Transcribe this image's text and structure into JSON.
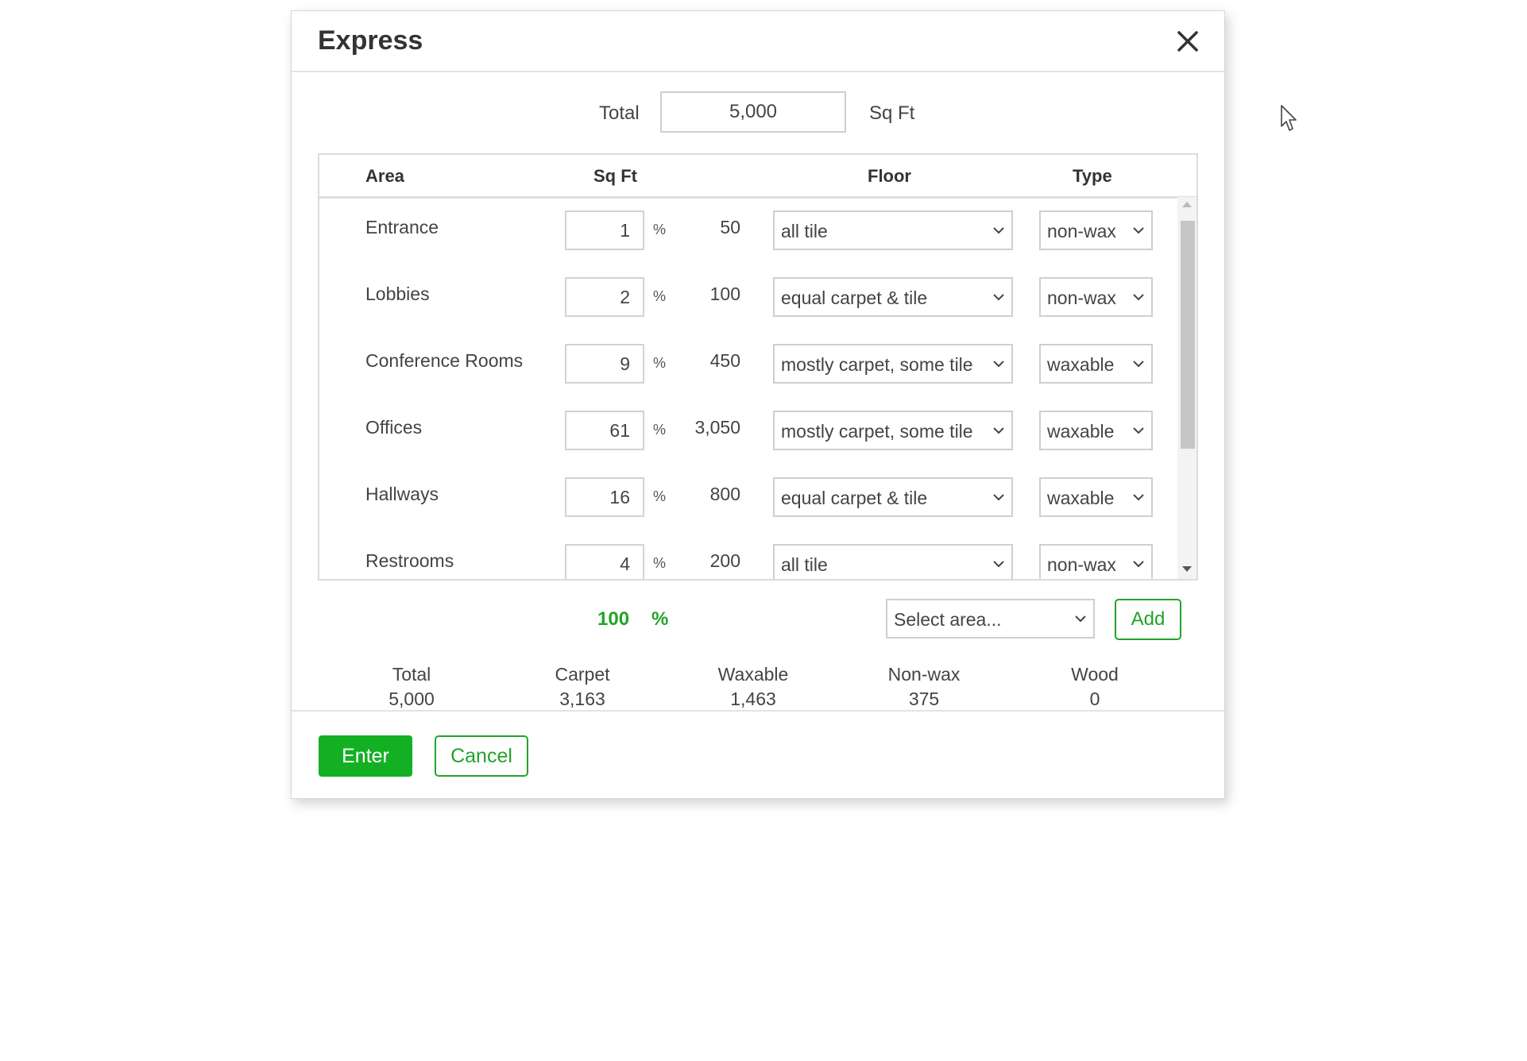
{
  "dialog": {
    "title": "Express",
    "total_label": "Total",
    "total_value": "5,000",
    "total_unit": "Sq Ft"
  },
  "table": {
    "headers": {
      "area": "Area",
      "sqft": "Sq Ft",
      "floor": "Floor",
      "type": "Type"
    },
    "rows": [
      {
        "area": "Entrance",
        "pct": "1",
        "pct_sign": "%",
        "sqft": "50",
        "floor": "all tile",
        "type": "non-wax"
      },
      {
        "area": "Lobbies",
        "pct": "2",
        "pct_sign": "%",
        "sqft": "100",
        "floor": "equal carpet & tile",
        "type": "non-wax"
      },
      {
        "area": "Conference Rooms",
        "pct": "9",
        "pct_sign": "%",
        "sqft": "450",
        "floor": "mostly carpet, some tile",
        "type": "waxable"
      },
      {
        "area": "Offices",
        "pct": "61",
        "pct_sign": "%",
        "sqft": "3,050",
        "floor": "mostly carpet, some tile",
        "type": "waxable"
      },
      {
        "area": "Hallways",
        "pct": "16",
        "pct_sign": "%",
        "sqft": "800",
        "floor": "equal carpet & tile",
        "type": "waxable"
      },
      {
        "area": "Restrooms",
        "pct": "4",
        "pct_sign": "%",
        "sqft": "200",
        "floor": "all tile",
        "type": "non-wax"
      }
    ]
  },
  "totals_row": {
    "pct": "100",
    "pct_sign": "%",
    "area_select_placeholder": "Select area...",
    "add_label": "Add"
  },
  "summary": {
    "total_label": "Total",
    "total_value": "5,000",
    "carpet_label": "Carpet",
    "carpet_value": "3,163",
    "waxable_label": "Waxable",
    "waxable_value": "1,463",
    "nonwax_label": "Non-wax",
    "nonwax_value": "375",
    "wood_label": "Wood",
    "wood_value": "0"
  },
  "footer": {
    "enter_label": "Enter",
    "cancel_label": "Cancel"
  },
  "colors": {
    "accent_green": "#22a32a",
    "enter_green": "#14b024"
  },
  "icons": {
    "close": "close-icon",
    "dropdown": "chevron-down-icon",
    "pointer": "mouse-pointer-icon"
  }
}
